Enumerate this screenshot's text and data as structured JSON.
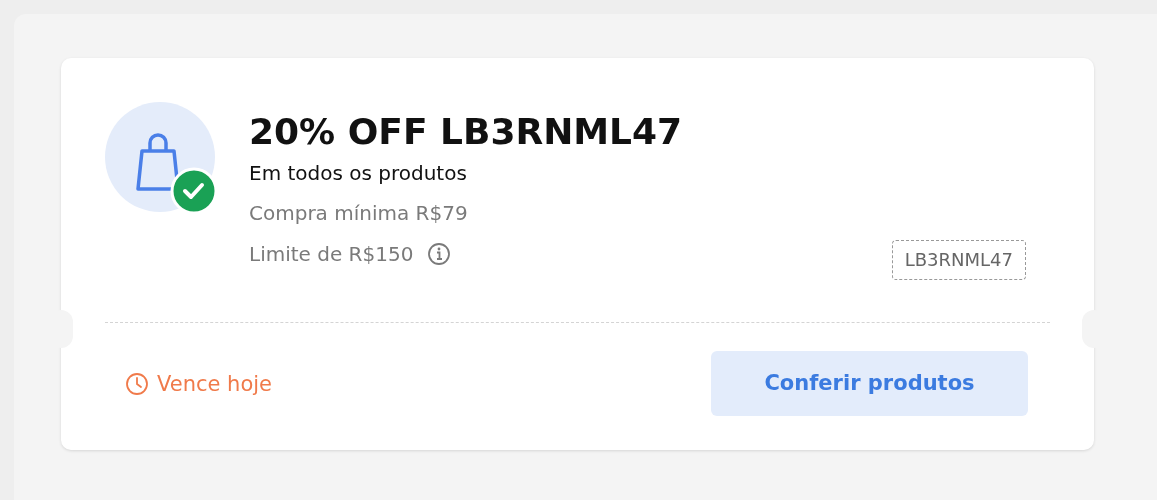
{
  "coupon": {
    "title": "20% OFF LB3RNML47",
    "scope": "Em todos os produtos",
    "minimum": "Compra mínima R$79",
    "limit": "Limite de R$150",
    "code": "LB3RNML47",
    "expiry": "Vence hoje",
    "action": "Conferir produtos"
  }
}
